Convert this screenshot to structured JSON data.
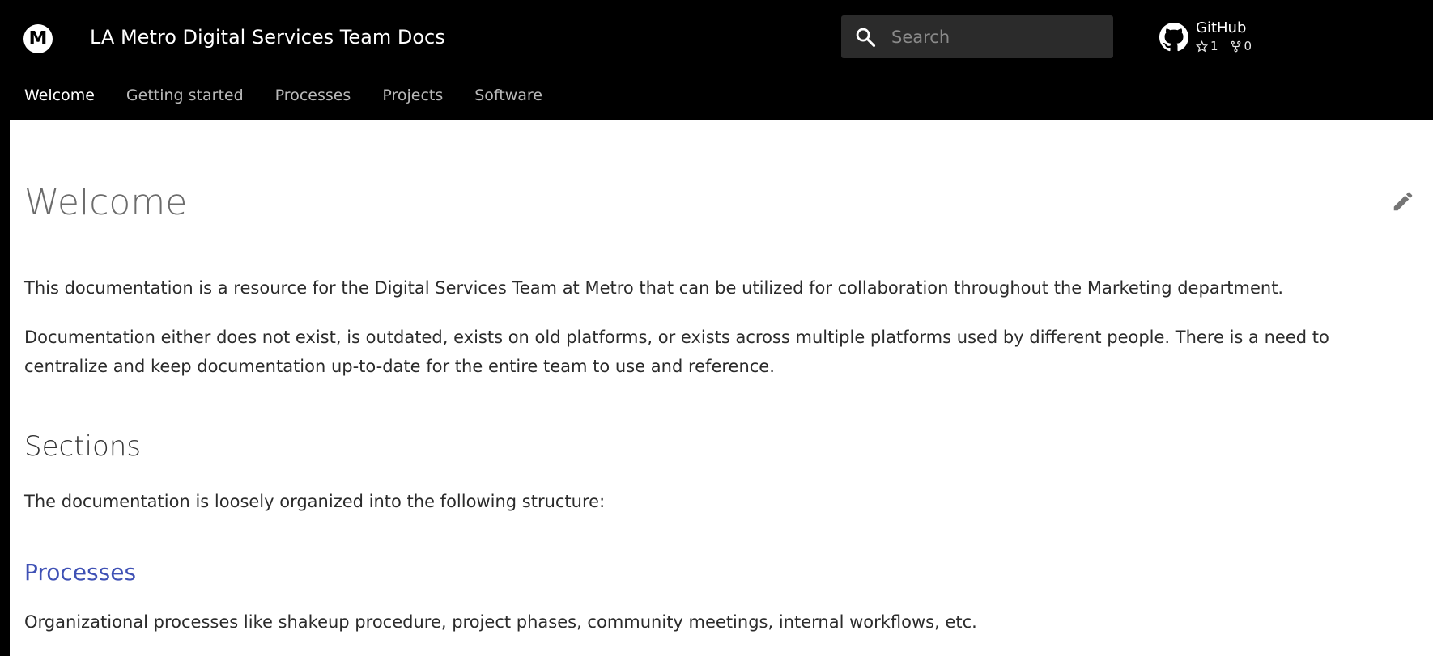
{
  "header": {
    "logo_letter": "M",
    "site_title": "LA Metro Digital Services Team Docs",
    "search": {
      "placeholder": "Search"
    },
    "repo": {
      "name": "GitHub",
      "stars": "1",
      "forks": "0"
    }
  },
  "tabs": [
    {
      "label": "Welcome",
      "active": true
    },
    {
      "label": "Getting started",
      "active": false
    },
    {
      "label": "Processes",
      "active": false
    },
    {
      "label": "Projects",
      "active": false
    },
    {
      "label": "Software",
      "active": false
    }
  ],
  "content": {
    "title": "Welcome",
    "intro_1": "This documentation is a resource for the Digital Services Team at Metro that can be utilized for collaboration throughout the Marketing department.",
    "intro_2": "Documentation either does not exist, is outdated, exists on old platforms, or exists across multiple platforms used by different people. There is a need to centralize and keep documentation up-to-date for the entire team to use and reference.",
    "sections_heading": "Sections",
    "sections_intro": "The documentation is loosely organized into the following structure:",
    "processes_heading": "Processes",
    "processes_text": "Organizational processes like shakeup procedure, project phases, community meetings, internal workflows, etc."
  },
  "icons": {
    "logo": "metro-logo-icon",
    "search": "search-icon",
    "repo": "github-icon",
    "star": "star-icon",
    "fork": "fork-icon",
    "edit": "edit-pencil-icon"
  },
  "colors": {
    "header_bg": "#000000",
    "content_bg": "#ffffff",
    "link": "#3f51b5",
    "search_bg": "#2b2b2b"
  }
}
